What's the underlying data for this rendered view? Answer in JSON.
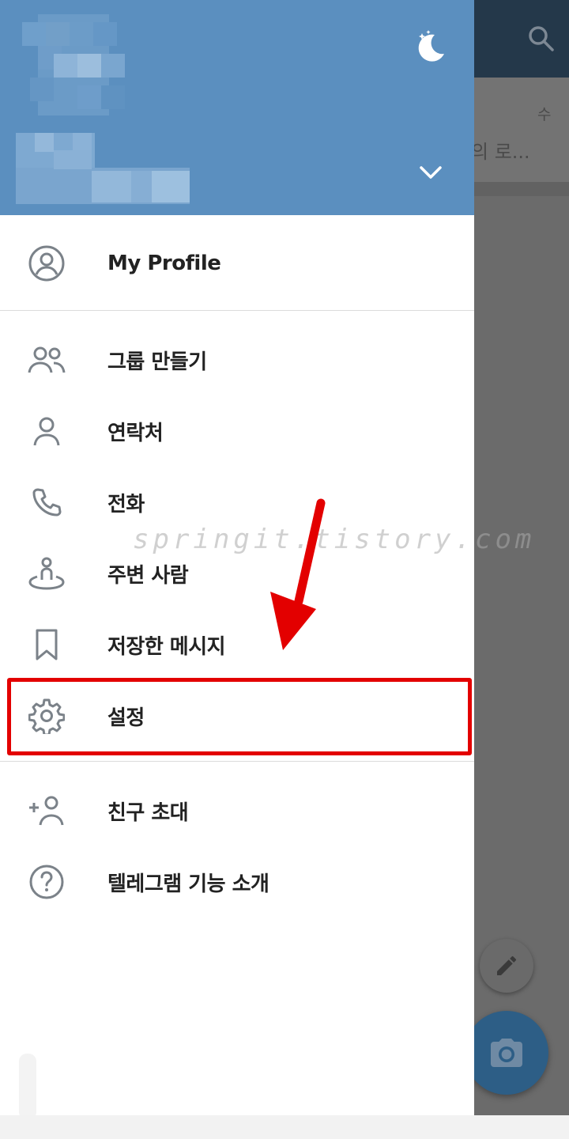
{
  "background": {
    "day_label": "수",
    "preview_text": "의 로...",
    "colors": {
      "topbar": "#24384a",
      "dim": "#6b6b6b",
      "camera_fab": "#2d5e86"
    }
  },
  "drawer": {
    "header_color": "#5b8fbf",
    "icons": {
      "theme": "night-mode-icon",
      "expand": "chevron-down-icon"
    },
    "profile_label": "My Profile",
    "menu": [
      {
        "label": "그룹 만들기",
        "icon": "group-icon"
      },
      {
        "label": "연락처",
        "icon": "contact-icon"
      },
      {
        "label": "전화",
        "icon": "phone-icon"
      },
      {
        "label": "주변 사람",
        "icon": "nearby-people-icon"
      },
      {
        "label": "저장한 메시지",
        "icon": "bookmark-icon"
      },
      {
        "label": "설정",
        "icon": "gear-icon"
      }
    ],
    "extra_menu": [
      {
        "label": "친구 초대",
        "icon": "add-user-icon"
      },
      {
        "label": "텔레그램 기능 소개",
        "icon": "help-icon"
      }
    ]
  },
  "watermark": "springit.tistory.com",
  "annotation_color": "#e30000"
}
